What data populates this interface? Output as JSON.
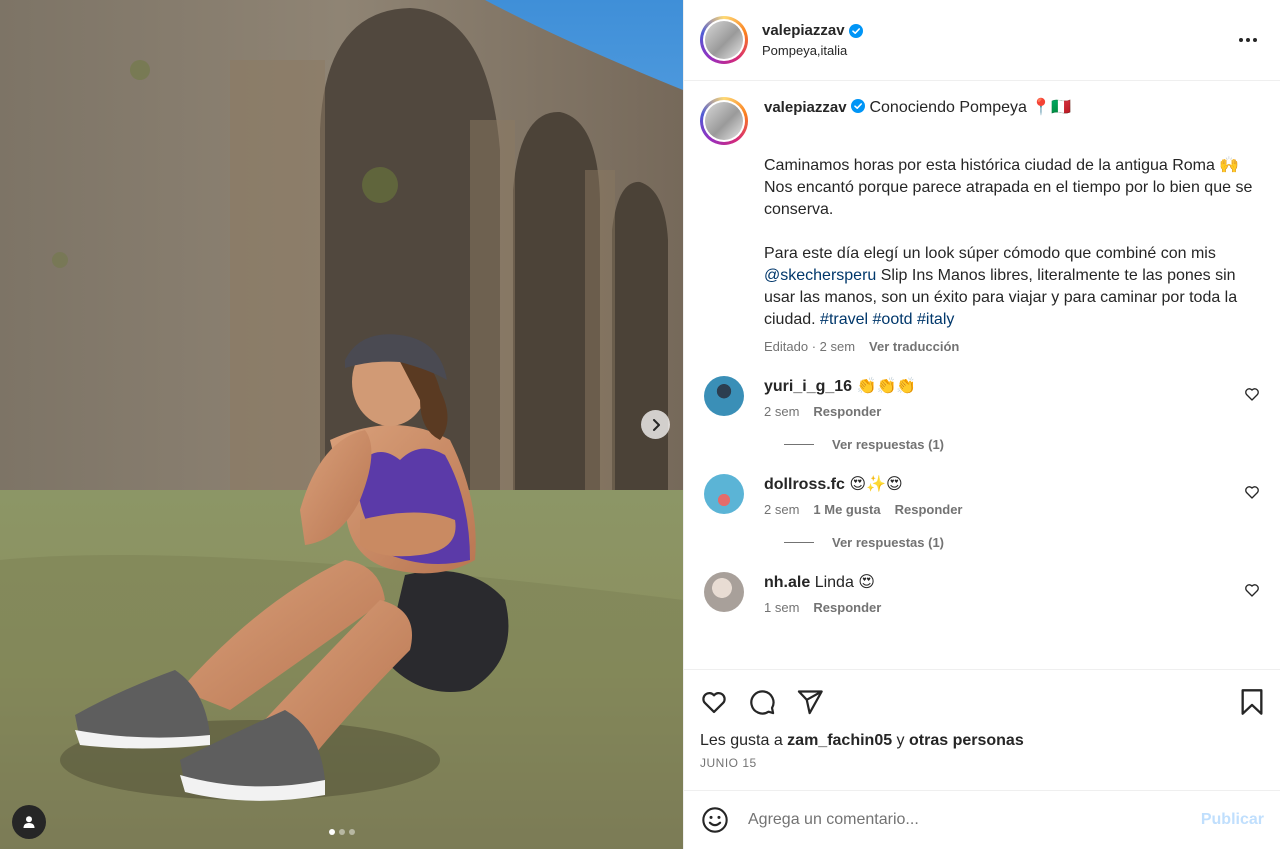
{
  "post_header": {
    "username": "valepiazzav",
    "location": "Pompeya,italia",
    "more_icon": "more-horizontal-icon"
  },
  "caption": {
    "username": "valepiazzav",
    "title": "Conociendo Pompeya 📍🇮🇹",
    "paragraph_1": "Caminamos horas por esta histórica ciudad de la antigua Roma 🙌 Nos encantó porque parece atrapada en el tiempo por lo bien que se conserva.",
    "paragraph_2_before": "Para este día elegí un look súper cómodo que combiné con mis ",
    "mention": "@skechersperu",
    "paragraph_2_after": " Slip Ins Manos libres, literalmente te las pones sin usar las manos, son un éxito para viajar y para caminar por toda la ciudad. ",
    "hashtags": [
      "#travel",
      "#ootd",
      "#italy"
    ],
    "edited": "Editado · 2 sem",
    "translate": "Ver traducción"
  },
  "comments": [
    {
      "username": "yuri_i_g_16",
      "text": "👏👏👏",
      "time": "2 sem",
      "likes": "",
      "reply": "Responder",
      "view_replies": "Ver respuestas (1)",
      "avatar_color": "#3a8fb7"
    },
    {
      "username": "dollross.fc",
      "text": "😍✨😍",
      "time": "2 sem",
      "likes": "1 Me gusta",
      "reply": "Responder",
      "view_replies": "Ver respuestas (1)",
      "avatar_color": "#5bb4d6"
    },
    {
      "username": "nh.ale",
      "text": "Linda 😍",
      "time": "1 sem",
      "likes": "",
      "reply": "Responder",
      "view_replies": "",
      "avatar_color": "#c9c2bd"
    }
  ],
  "actions": {
    "like_icon": "heart-icon",
    "comment_icon": "comment-icon",
    "share_icon": "send-icon",
    "save_icon": "bookmark-icon"
  },
  "likes": {
    "prefix": "Les gusta a ",
    "user": "zam_fachin05",
    "middle": " y ",
    "others": "otras personas"
  },
  "date": "JUNIO 15",
  "composer": {
    "placeholder": "Agrega un comentario...",
    "publish": "Publicar"
  },
  "colors": {
    "verified": "#0095f6",
    "link": "#00376b",
    "muted": "#737373",
    "publish_disabled": "#c0dffd"
  }
}
